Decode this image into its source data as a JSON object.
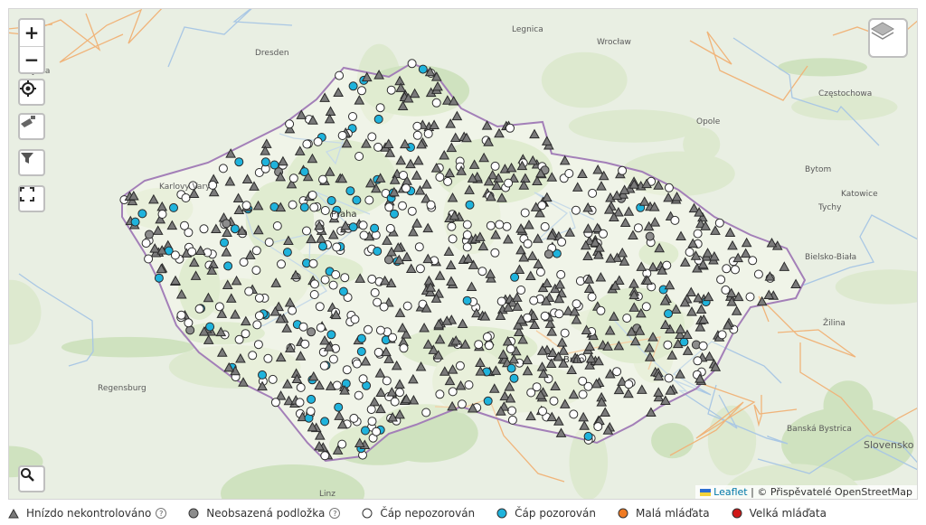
{
  "map": {
    "attribution_link": "Leaflet",
    "attribution_sep": "|",
    "attribution_text": "© Přispěvatelé OpenStreetMap",
    "places": [
      {
        "name": "Dresden",
        "cls": "city"
      },
      {
        "name": "Wrocław",
        "cls": "city"
      },
      {
        "name": "Praha",
        "cls": "city"
      },
      {
        "name": "Brno",
        "cls": "city"
      },
      {
        "name": "Jena",
        "cls": "small"
      },
      {
        "name": "Karlovy Vary",
        "cls": "small"
      },
      {
        "name": "Regensburg",
        "cls": "small"
      },
      {
        "name": "Linz",
        "cls": "small"
      },
      {
        "name": "Legnica",
        "cls": "small"
      },
      {
        "name": "Opole",
        "cls": "small"
      },
      {
        "name": "Częstochowa",
        "cls": "small"
      },
      {
        "name": "Katowice",
        "cls": "small"
      },
      {
        "name": "Bielsko-Biała",
        "cls": "small"
      },
      {
        "name": "Bytom",
        "cls": "small"
      },
      {
        "name": "Tychy",
        "cls": "small"
      },
      {
        "name": "Žilina",
        "cls": "small"
      },
      {
        "name": "Banská Bystrica",
        "cls": "small"
      },
      {
        "name": "Slovensko",
        "cls": "country"
      }
    ]
  },
  "controls": {
    "zoom_in": "+",
    "zoom_out": "−"
  },
  "icons": [
    "plus-icon",
    "minus-icon",
    "locate-icon",
    "camera-icon",
    "filter-icon",
    "fullscreen-icon",
    "search-icon",
    "layers-icon"
  ],
  "legend": [
    {
      "label": "Hnízdo nekontrolováno",
      "shape": "triangle",
      "color": "#7a7a7a",
      "help": "?"
    },
    {
      "label": "Neobsazená podložka",
      "shape": "circle",
      "color": "#8c8c8c",
      "help": "?"
    },
    {
      "label": "Čáp nepozorován",
      "shape": "circle",
      "color": "#ffffff"
    },
    {
      "label": "Čáp pozorován",
      "shape": "circle",
      "color": "#1fb3dc"
    },
    {
      "label": "Malá mláďata",
      "shape": "circle",
      "color": "#ef7a22"
    },
    {
      "label": "Velká mláďata",
      "shape": "circle",
      "color": "#d01818"
    }
  ],
  "colors": {
    "triangle": "#7a7a7a",
    "unoccupied": "#8c8c8c",
    "not_observed": "#ffffff",
    "observed": "#1fb3dc",
    "border": "#9b59b6"
  }
}
